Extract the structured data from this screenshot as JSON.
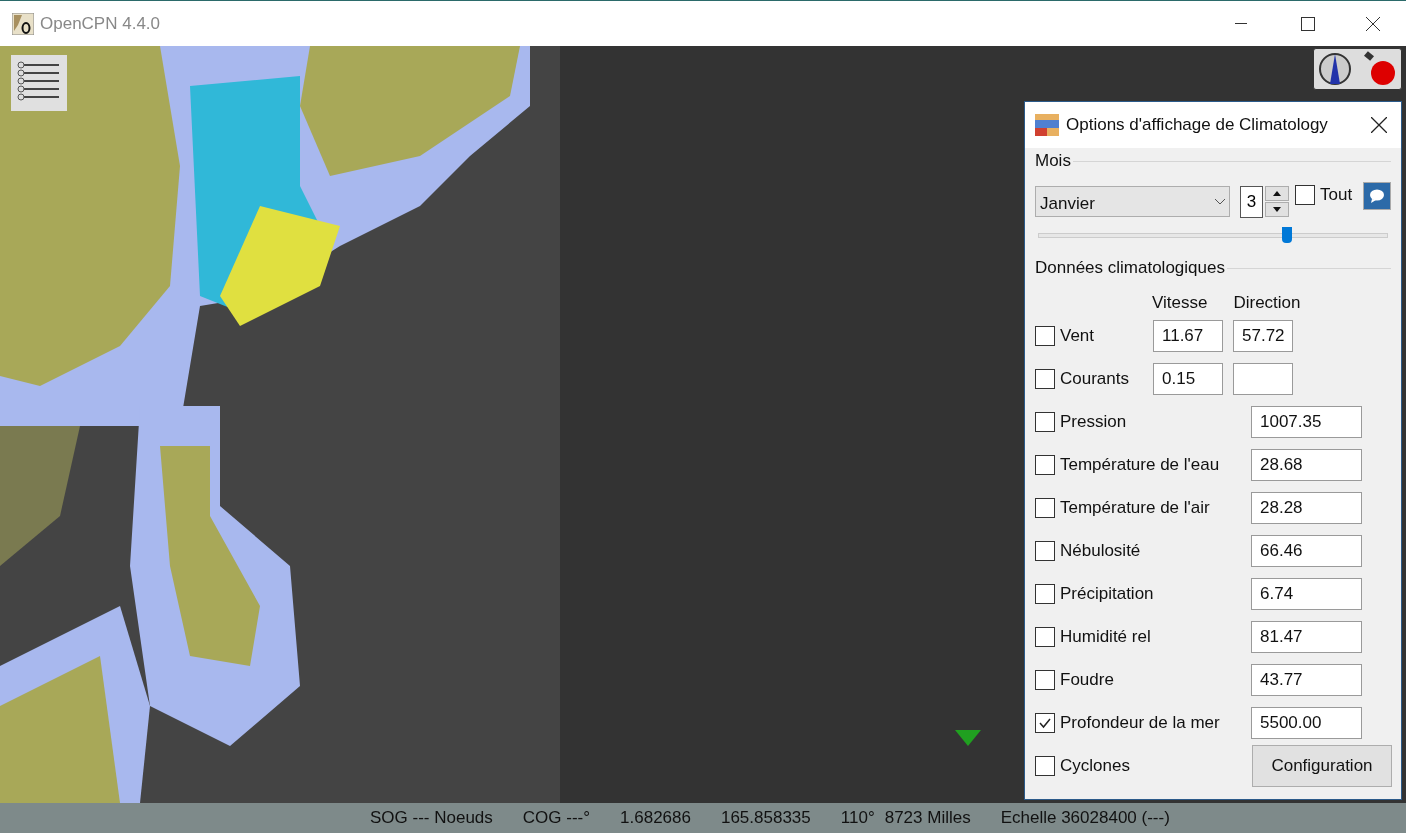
{
  "window": {
    "title": "OpenCPN 4.4.0"
  },
  "dialog": {
    "title": "Options d'affichage de Climatology",
    "month_section": {
      "label": "Mois",
      "month": "Janvier",
      "spin_value": "3",
      "all": {
        "label": "Tout",
        "checked": false
      },
      "slider": {
        "level": 0.71
      }
    },
    "data_section": {
      "label": "Données climatologiques",
      "col_headers": [
        "Vitesse",
        "Direction"
      ],
      "rows": [
        {
          "kind": "pair",
          "label": "Vent",
          "checked": false,
          "speed": "11.67",
          "direction": "57.72"
        },
        {
          "kind": "pair",
          "label": "Courants",
          "checked": false,
          "speed": "0.15"
        },
        {
          "kind": "single",
          "label": "Pression",
          "checked": false,
          "value": "1007.35"
        },
        {
          "kind": "single",
          "label": "Température de l'eau",
          "checked": false,
          "value": "28.68"
        },
        {
          "kind": "single",
          "label": "Température de l'air",
          "checked": false,
          "value": "28.28"
        },
        {
          "kind": "single",
          "label": "Nébulosité",
          "checked": false,
          "value": "66.46"
        },
        {
          "kind": "single",
          "label": "Précipitation",
          "checked": false,
          "value": "6.74"
        },
        {
          "kind": "single",
          "label": "Humidité rel",
          "checked": false,
          "value": "81.47"
        },
        {
          "kind": "single",
          "label": "Foudre",
          "checked": false,
          "value": "43.77"
        },
        {
          "kind": "single",
          "label": "Profondeur de la mer",
          "checked": true,
          "value": "5500.00"
        },
        {
          "kind": "button",
          "label": "Cyclones",
          "checked": false,
          "button": "Configuration"
        }
      ]
    }
  },
  "status_bar": [
    {
      "kind": "wide",
      "text": "SOG --- Noeuds"
    },
    {
      "kind": "wide",
      "text": "COG ---°"
    },
    {
      "kind": "wide",
      "text": "1.682686"
    },
    {
      "kind": "wide",
      "text": "165.858335"
    },
    {
      "kind": "narrow",
      "text": "110°"
    },
    {
      "kind": "wide",
      "text": "8723 Milles"
    },
    {
      "kind": "wide",
      "text": "Echelle 36028400 (---)"
    }
  ]
}
